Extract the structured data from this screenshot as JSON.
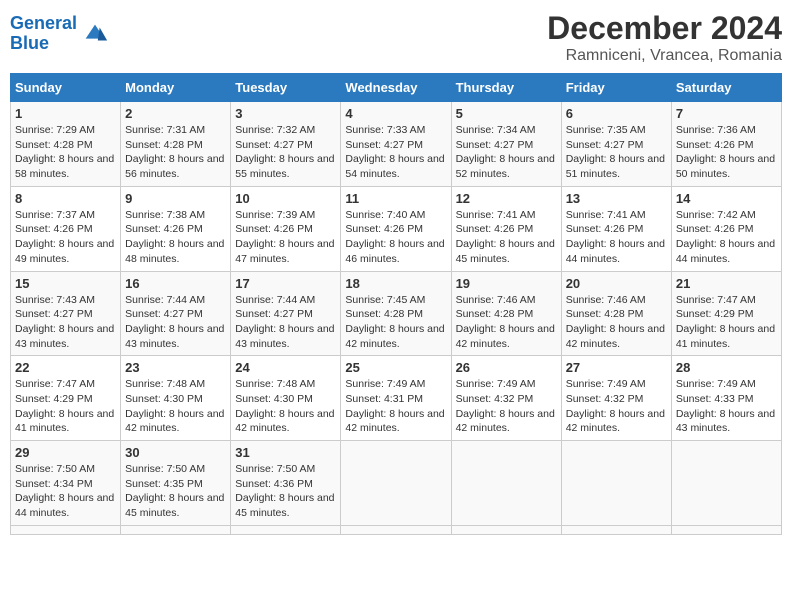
{
  "header": {
    "logo_line1": "General",
    "logo_line2": "Blue",
    "title": "December 2024",
    "subtitle": "Ramniceni, Vrancea, Romania"
  },
  "calendar": {
    "weekdays": [
      "Sunday",
      "Monday",
      "Tuesday",
      "Wednesday",
      "Thursday",
      "Friday",
      "Saturday"
    ],
    "weeks": [
      [
        null,
        null,
        null,
        null,
        null,
        null,
        null
      ],
      [
        null,
        null,
        null,
        null,
        null,
        null,
        null
      ],
      [
        null,
        null,
        null,
        null,
        null,
        null,
        null
      ],
      [
        null,
        null,
        null,
        null,
        null,
        null,
        null
      ],
      [
        null,
        null,
        null,
        null,
        null,
        null,
        null
      ],
      [
        null,
        null,
        null,
        null,
        null,
        null,
        null
      ]
    ],
    "days": [
      {
        "date": 1,
        "dow": 0,
        "sunrise": "7:29 AM",
        "sunset": "4:28 PM",
        "daylight": "8 hours and 58 minutes."
      },
      {
        "date": 2,
        "dow": 1,
        "sunrise": "7:31 AM",
        "sunset": "4:28 PM",
        "daylight": "8 hours and 56 minutes."
      },
      {
        "date": 3,
        "dow": 2,
        "sunrise": "7:32 AM",
        "sunset": "4:27 PM",
        "daylight": "8 hours and 55 minutes."
      },
      {
        "date": 4,
        "dow": 3,
        "sunrise": "7:33 AM",
        "sunset": "4:27 PM",
        "daylight": "8 hours and 54 minutes."
      },
      {
        "date": 5,
        "dow": 4,
        "sunrise": "7:34 AM",
        "sunset": "4:27 PM",
        "daylight": "8 hours and 52 minutes."
      },
      {
        "date": 6,
        "dow": 5,
        "sunrise": "7:35 AM",
        "sunset": "4:27 PM",
        "daylight": "8 hours and 51 minutes."
      },
      {
        "date": 7,
        "dow": 6,
        "sunrise": "7:36 AM",
        "sunset": "4:26 PM",
        "daylight": "8 hours and 50 minutes."
      },
      {
        "date": 8,
        "dow": 0,
        "sunrise": "7:37 AM",
        "sunset": "4:26 PM",
        "daylight": "8 hours and 49 minutes."
      },
      {
        "date": 9,
        "dow": 1,
        "sunrise": "7:38 AM",
        "sunset": "4:26 PM",
        "daylight": "8 hours and 48 minutes."
      },
      {
        "date": 10,
        "dow": 2,
        "sunrise": "7:39 AM",
        "sunset": "4:26 PM",
        "daylight": "8 hours and 47 minutes."
      },
      {
        "date": 11,
        "dow": 3,
        "sunrise": "7:40 AM",
        "sunset": "4:26 PM",
        "daylight": "8 hours and 46 minutes."
      },
      {
        "date": 12,
        "dow": 4,
        "sunrise": "7:41 AM",
        "sunset": "4:26 PM",
        "daylight": "8 hours and 45 minutes."
      },
      {
        "date": 13,
        "dow": 5,
        "sunrise": "7:41 AM",
        "sunset": "4:26 PM",
        "daylight": "8 hours and 44 minutes."
      },
      {
        "date": 14,
        "dow": 6,
        "sunrise": "7:42 AM",
        "sunset": "4:26 PM",
        "daylight": "8 hours and 44 minutes."
      },
      {
        "date": 15,
        "dow": 0,
        "sunrise": "7:43 AM",
        "sunset": "4:27 PM",
        "daylight": "8 hours and 43 minutes."
      },
      {
        "date": 16,
        "dow": 1,
        "sunrise": "7:44 AM",
        "sunset": "4:27 PM",
        "daylight": "8 hours and 43 minutes."
      },
      {
        "date": 17,
        "dow": 2,
        "sunrise": "7:44 AM",
        "sunset": "4:27 PM",
        "daylight": "8 hours and 43 minutes."
      },
      {
        "date": 18,
        "dow": 3,
        "sunrise": "7:45 AM",
        "sunset": "4:28 PM",
        "daylight": "8 hours and 42 minutes."
      },
      {
        "date": 19,
        "dow": 4,
        "sunrise": "7:46 AM",
        "sunset": "4:28 PM",
        "daylight": "8 hours and 42 minutes."
      },
      {
        "date": 20,
        "dow": 5,
        "sunrise": "7:46 AM",
        "sunset": "4:28 PM",
        "daylight": "8 hours and 42 minutes."
      },
      {
        "date": 21,
        "dow": 6,
        "sunrise": "7:47 AM",
        "sunset": "4:29 PM",
        "daylight": "8 hours and 41 minutes."
      },
      {
        "date": 22,
        "dow": 0,
        "sunrise": "7:47 AM",
        "sunset": "4:29 PM",
        "daylight": "8 hours and 41 minutes."
      },
      {
        "date": 23,
        "dow": 1,
        "sunrise": "7:48 AM",
        "sunset": "4:30 PM",
        "daylight": "8 hours and 42 minutes."
      },
      {
        "date": 24,
        "dow": 2,
        "sunrise": "7:48 AM",
        "sunset": "4:30 PM",
        "daylight": "8 hours and 42 minutes."
      },
      {
        "date": 25,
        "dow": 3,
        "sunrise": "7:49 AM",
        "sunset": "4:31 PM",
        "daylight": "8 hours and 42 minutes."
      },
      {
        "date": 26,
        "dow": 4,
        "sunrise": "7:49 AM",
        "sunset": "4:32 PM",
        "daylight": "8 hours and 42 minutes."
      },
      {
        "date": 27,
        "dow": 5,
        "sunrise": "7:49 AM",
        "sunset": "4:32 PM",
        "daylight": "8 hours and 42 minutes."
      },
      {
        "date": 28,
        "dow": 6,
        "sunrise": "7:49 AM",
        "sunset": "4:33 PM",
        "daylight": "8 hours and 43 minutes."
      },
      {
        "date": 29,
        "dow": 0,
        "sunrise": "7:50 AM",
        "sunset": "4:34 PM",
        "daylight": "8 hours and 44 minutes."
      },
      {
        "date": 30,
        "dow": 1,
        "sunrise": "7:50 AM",
        "sunset": "4:35 PM",
        "daylight": "8 hours and 45 minutes."
      },
      {
        "date": 31,
        "dow": 2,
        "sunrise": "7:50 AM",
        "sunset": "4:36 PM",
        "daylight": "8 hours and 45 minutes."
      }
    ]
  }
}
